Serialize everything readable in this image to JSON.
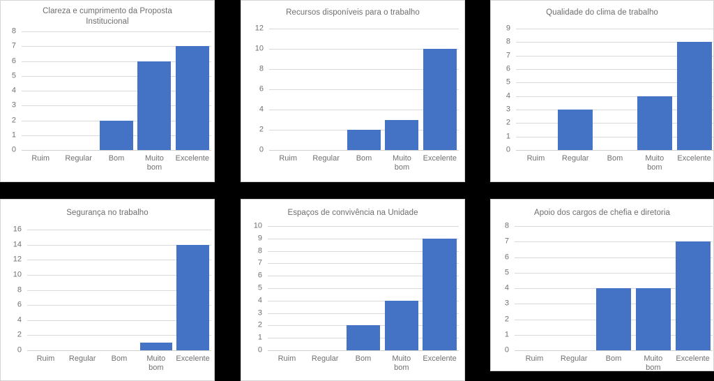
{
  "layout": {
    "background_color": "#000000",
    "panel_background": "#ffffff",
    "bar_color": "#4472c4",
    "gridline_color": "#d9d9d9",
    "title_color": "#6e6e6e",
    "tick_color": "#707070",
    "rows": 2,
    "columns": 3
  },
  "chart_data": [
    {
      "type": "bar",
      "title": "Clareza e cumprimento da Proposta\nInstitucional",
      "categories": [
        "Ruim",
        "Regular",
        "Bom",
        "Muito\nbom",
        "Excelente"
      ],
      "values": [
        0,
        0,
        2,
        6,
        7
      ],
      "xlabel": "",
      "ylabel": "",
      "ylim": [
        0,
        8
      ],
      "ytick_step": 1,
      "yticks": [
        0,
        1,
        2,
        3,
        4,
        5,
        6,
        7,
        8
      ],
      "grid": true,
      "legend": false
    },
    {
      "type": "bar",
      "title": "Recursos disponíveis para o trabalho",
      "categories": [
        "Ruim",
        "Regular",
        "Bom",
        "Muito\nbom",
        "Excelente"
      ],
      "values": [
        0,
        0,
        2,
        3,
        10
      ],
      "xlabel": "",
      "ylabel": "",
      "ylim": [
        0,
        12
      ],
      "ytick_step": 2,
      "yticks": [
        0,
        2,
        4,
        6,
        8,
        10,
        12
      ],
      "grid": true,
      "legend": false
    },
    {
      "type": "bar",
      "title": "Qualidade do clima de trabalho",
      "categories": [
        "Ruim",
        "Regular",
        "Bom",
        "Muito\nbom",
        "Excelente"
      ],
      "values": [
        0,
        3,
        0,
        4,
        8
      ],
      "xlabel": "",
      "ylabel": "",
      "ylim": [
        0,
        9
      ],
      "ytick_step": 1,
      "yticks": [
        0,
        1,
        2,
        3,
        4,
        5,
        6,
        7,
        8,
        9
      ],
      "grid": true,
      "legend": false
    },
    {
      "type": "bar",
      "title": "Segurança no trabalho",
      "categories": [
        "Ruim",
        "Regular",
        "Bom",
        "Muito\nbom",
        "Excelente"
      ],
      "values": [
        0,
        0,
        0,
        1,
        14
      ],
      "xlabel": "",
      "ylabel": "",
      "ylim": [
        0,
        16
      ],
      "ytick_step": 2,
      "yticks": [
        0,
        2,
        4,
        6,
        8,
        10,
        12,
        14,
        16
      ],
      "grid": true,
      "legend": false
    },
    {
      "type": "bar",
      "title": "Espaços de convivência na Unidade",
      "categories": [
        "Ruim",
        "Regular",
        "Bom",
        "Muito\nbom",
        "Excelente"
      ],
      "values": [
        0,
        0,
        2,
        4,
        9
      ],
      "xlabel": "",
      "ylabel": "",
      "ylim": [
        0,
        10
      ],
      "ytick_step": 1,
      "yticks": [
        0,
        1,
        2,
        3,
        4,
        5,
        6,
        7,
        8,
        9,
        10
      ],
      "grid": true,
      "legend": false
    },
    {
      "type": "bar",
      "title": "Apoio dos cargos de chefia e diretoria",
      "categories": [
        "Ruim",
        "Regular",
        "Bom",
        "Muito\nbom",
        "Excelente"
      ],
      "values": [
        0,
        0,
        4,
        4,
        7
      ],
      "xlabel": "",
      "ylabel": "",
      "ylim": [
        0,
        8
      ],
      "ytick_step": 1,
      "yticks": [
        0,
        1,
        2,
        3,
        4,
        5,
        6,
        7,
        8
      ],
      "grid": true,
      "legend": false
    }
  ]
}
